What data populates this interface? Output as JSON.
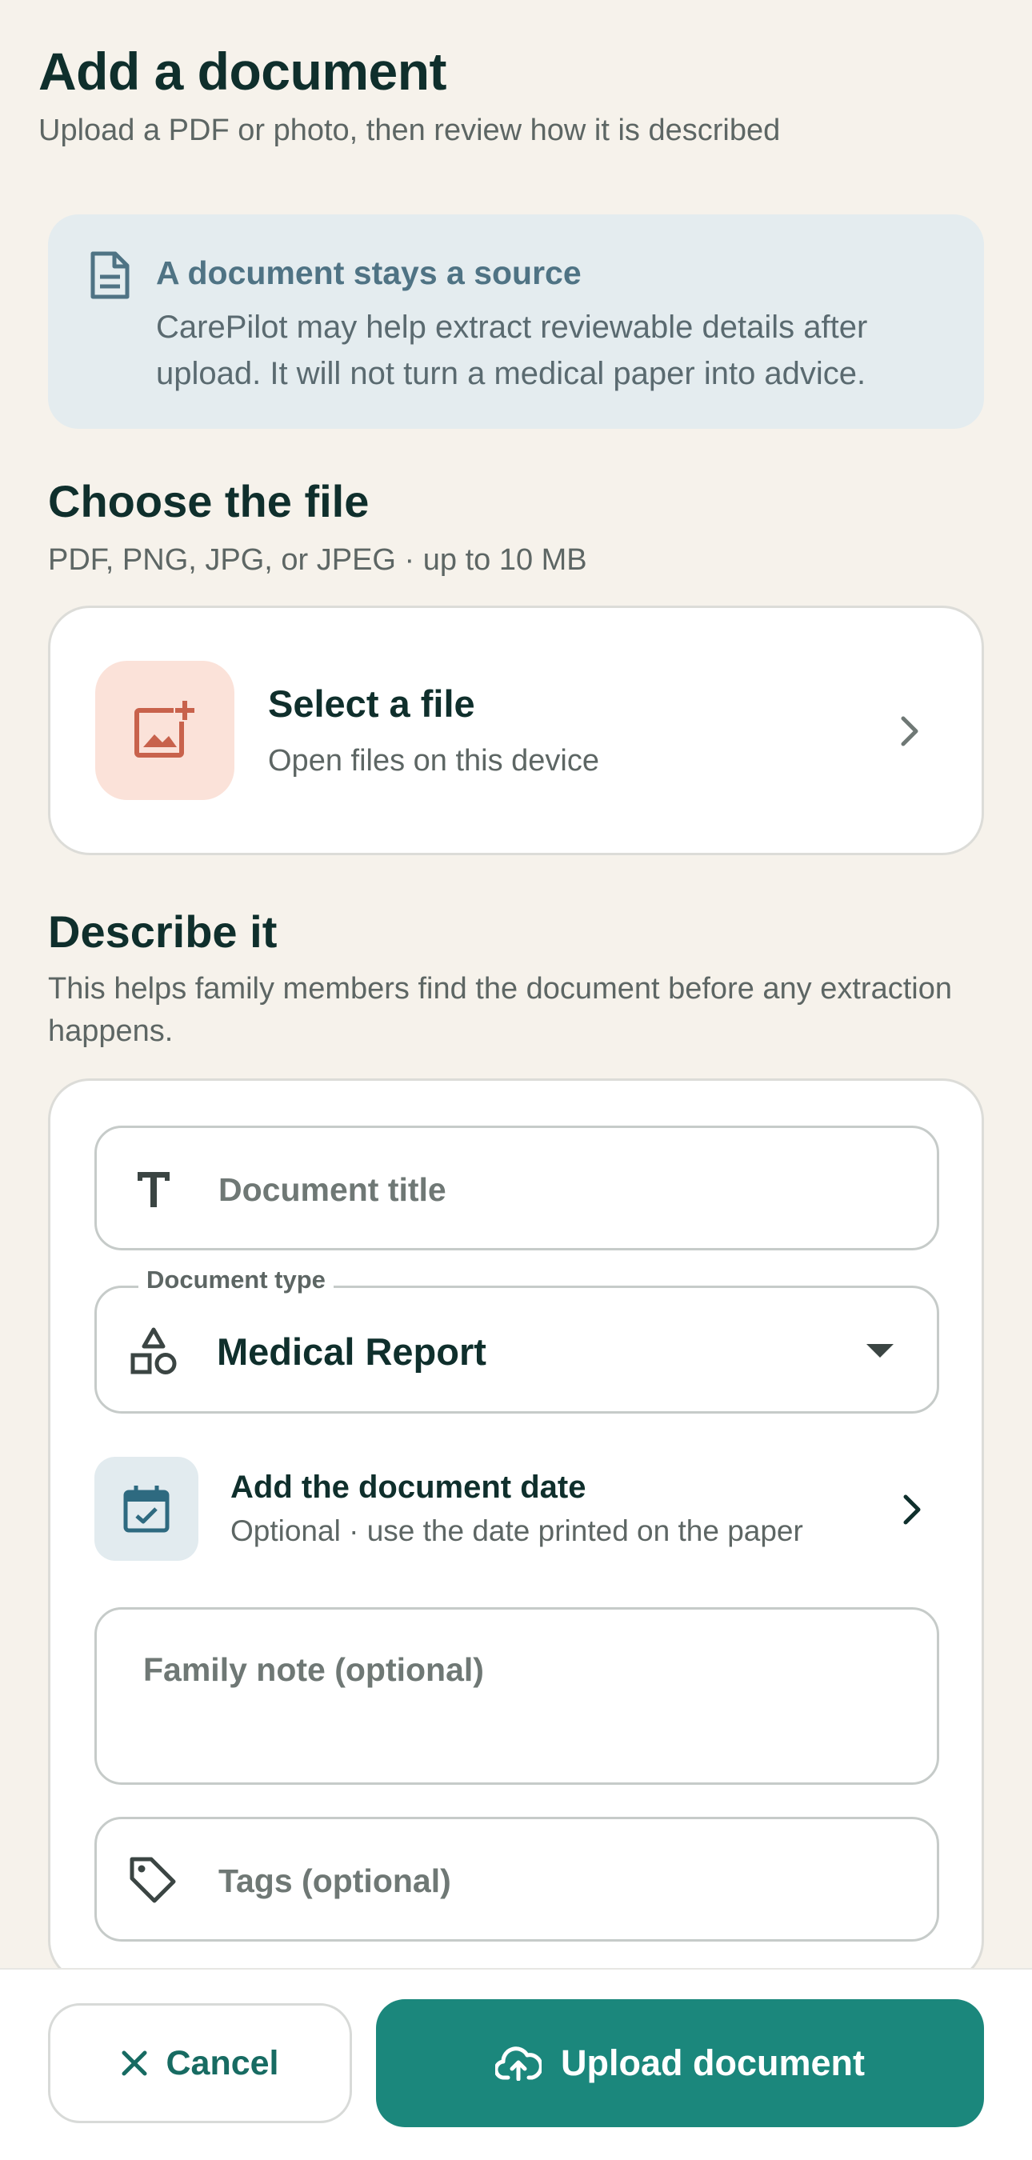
{
  "header": {
    "title": "Add a document",
    "subtitle": "Upload a PDF or photo, then review how it is described"
  },
  "info_banner": {
    "icon": "document-icon",
    "title": "A document stays a source",
    "body": "CarePilot may help extract reviewable details after upload. It will not turn a medical paper into advice."
  },
  "file_section": {
    "title": "Choose the file",
    "subtitle": "PDF, PNG, JPG, or JPEG · up to 10 MB",
    "picker": {
      "icon": "add-image-icon",
      "title": "Select a file",
      "subtitle": "Open files on this device"
    }
  },
  "describe_section": {
    "title": "Describe it",
    "subtitle": "This helps family members find the document before any extraction happens.",
    "title_field": {
      "icon": "text-icon",
      "placeholder": "Document title",
      "value": ""
    },
    "type_field": {
      "label": "Document type",
      "icon": "shapes-icon",
      "value": "Medical Report"
    },
    "date_row": {
      "icon": "calendar-check-icon",
      "title": "Add the document date",
      "subtitle": "Optional · use the date printed on the paper"
    },
    "note_field": {
      "placeholder": "Family note (optional)",
      "value": ""
    },
    "tags_field": {
      "icon": "tag-icon",
      "placeholder": "Tags (optional)",
      "value": ""
    }
  },
  "actions": {
    "cancel": {
      "icon": "close-icon",
      "label": "Cancel"
    },
    "upload": {
      "icon": "cloud-upload-icon",
      "label": "Upload document"
    }
  },
  "colors": {
    "background": "#f6f2eb",
    "primary": "#1b877c",
    "banner": "#e4ecef",
    "thumb": "#fbe2d9",
    "thumb_icon": "#c8624c"
  }
}
